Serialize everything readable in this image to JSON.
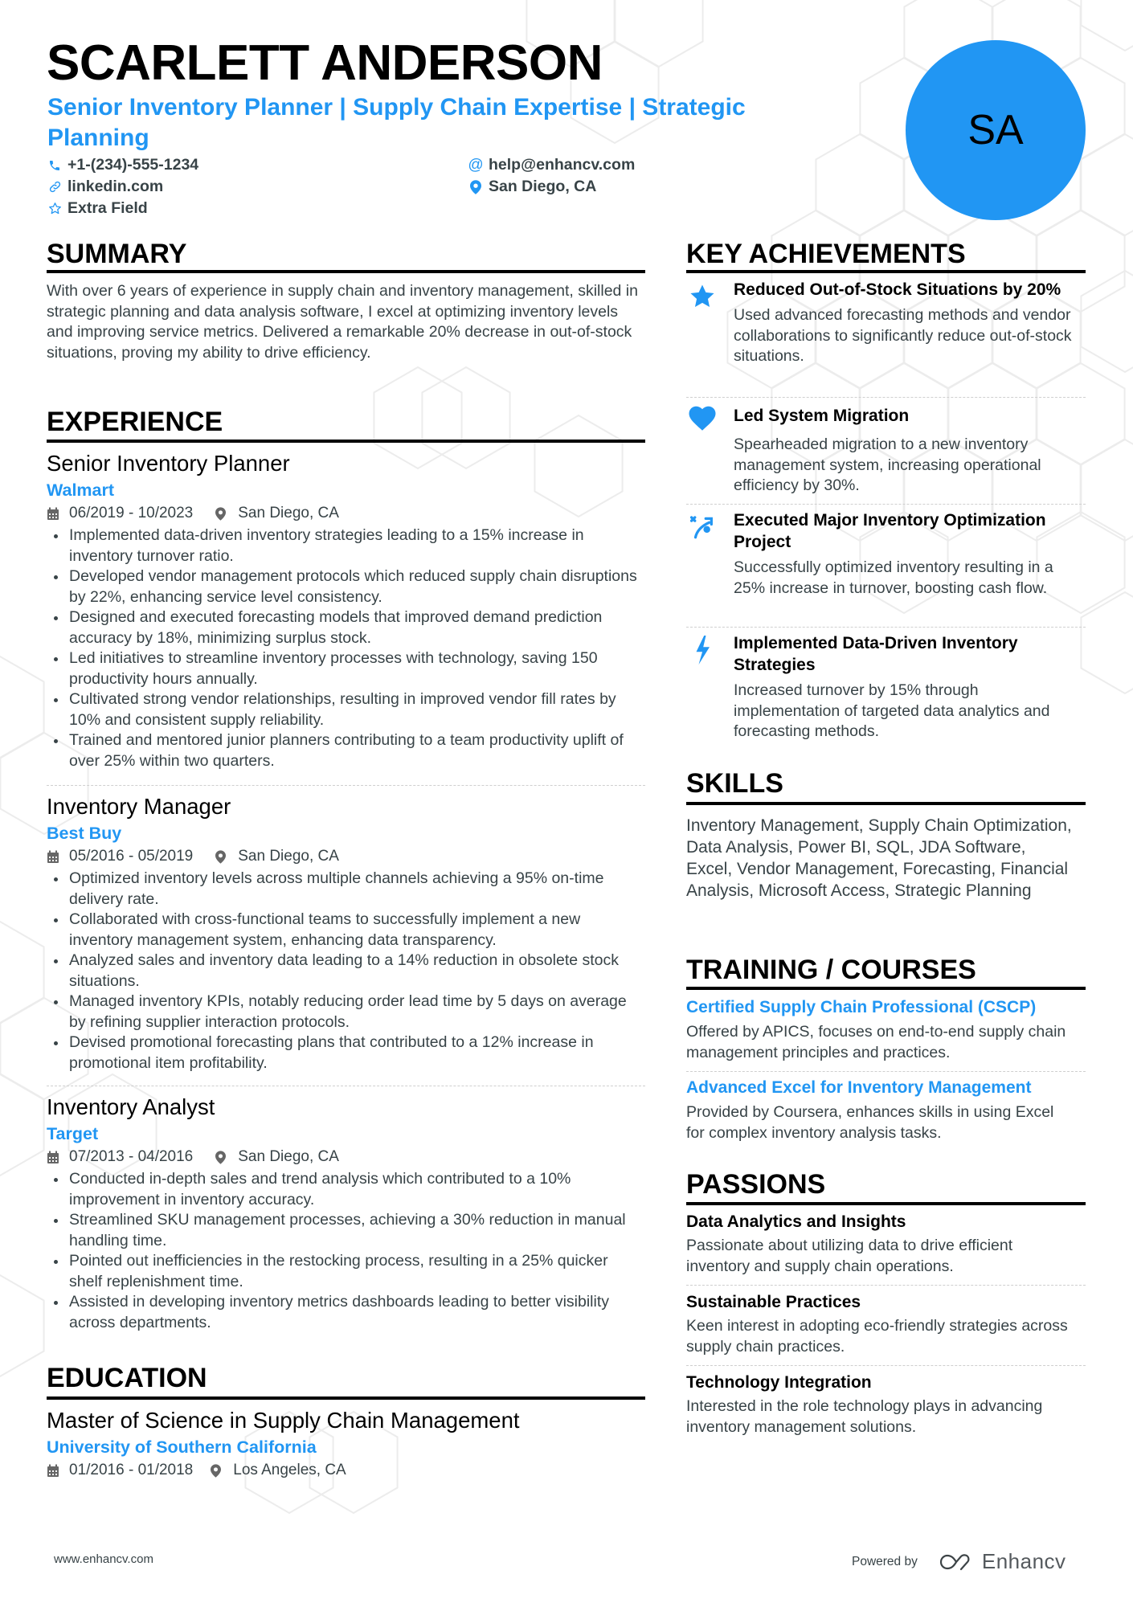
{
  "header": {
    "name": "SCARLETT ANDERSON",
    "title": "Senior Inventory Planner | Supply Chain Expertise | Strategic Planning",
    "initials": "SA",
    "contacts": {
      "phone": "+1-(234)-555-1234",
      "email": "help@enhancv.com",
      "linkedin": "linkedin.com",
      "location": "San Diego, CA",
      "extra": "Extra Field"
    }
  },
  "colors": {
    "accent": "#2196F3",
    "text": "#384347",
    "heading": "#000000"
  },
  "summary": {
    "heading": "SUMMARY",
    "text": "With over 6 years of experience in supply chain and inventory management, skilled in strategic planning and data analysis software, I excel at optimizing inventory levels and improving service metrics. Delivered a remarkable 20% decrease in out-of-stock situations, proving my ability to drive efficiency."
  },
  "experience": {
    "heading": "EXPERIENCE",
    "jobs": [
      {
        "title": "Senior Inventory Planner",
        "company": "Walmart",
        "dates": "06/2019 - 10/2023",
        "location": "San Diego, CA",
        "bullets": [
          "Implemented data-driven inventory strategies leading to a 15% increase in inventory turnover ratio.",
          "Developed vendor management protocols which reduced supply chain disruptions by 22%, enhancing service level consistency.",
          "Designed and executed forecasting models that improved demand prediction accuracy by 18%, minimizing surplus stock.",
          "Led initiatives to streamline inventory processes with technology, saving 150 productivity hours annually.",
          "Cultivated strong vendor relationships, resulting in improved vendor fill rates by 10% and consistent supply reliability.",
          "Trained and mentored junior planners contributing to a team productivity uplift of over 25% within two quarters."
        ]
      },
      {
        "title": "Inventory Manager",
        "company": "Best Buy",
        "dates": "05/2016 - 05/2019",
        "location": "San Diego, CA",
        "bullets": [
          "Optimized inventory levels across multiple channels achieving a 95% on-time delivery rate.",
          "Collaborated with cross-functional teams to successfully implement a new inventory management system, enhancing data transparency.",
          "Analyzed sales and inventory data leading to a 14% reduction in obsolete stock situations.",
          "Managed inventory KPIs, notably reducing order lead time by 5 days on average by refining supplier interaction protocols.",
          "Devised promotional forecasting plans that contributed to a 12% increase in promotional item profitability."
        ]
      },
      {
        "title": "Inventory Analyst",
        "company": "Target",
        "dates": "07/2013 - 04/2016",
        "location": "San Diego, CA",
        "bullets": [
          "Conducted in-depth sales and trend analysis which contributed to a 10% improvement in inventory accuracy.",
          "Streamlined SKU management processes, achieving a 30% reduction in manual handling time.",
          "Pointed out inefficiencies in the restocking process, resulting in a 25% quicker shelf replenishment time.",
          "Assisted in developing inventory metrics dashboards leading to better visibility across departments."
        ]
      }
    ]
  },
  "education": {
    "heading": "EDUCATION",
    "degree": "Master of Science in Supply Chain Management",
    "school": "University of Southern California",
    "dates": "01/2016 - 01/2018",
    "location": "Los Angeles, CA"
  },
  "achievements": {
    "heading": "KEY ACHIEVEMENTS",
    "items": [
      {
        "icon": "star-icon",
        "title": "Reduced Out-of-Stock Situations by 20%",
        "desc": "Used advanced forecasting methods and vendor collaborations to significantly reduce out-of-stock situations."
      },
      {
        "icon": "heart-icon",
        "title": "Led System Migration",
        "desc": "Spearheaded migration to a new inventory management system, increasing operational efficiency by 30%."
      },
      {
        "icon": "strategy-icon",
        "title": "Executed Major Inventory Optimization Project",
        "desc": "Successfully optimized inventory resulting in a 25% increase in turnover, boosting cash flow."
      },
      {
        "icon": "bolt-icon",
        "title": "Implemented Data-Driven Inventory Strategies",
        "desc": "Increased turnover by 15% through implementation of targeted data analytics and forecasting methods."
      }
    ]
  },
  "skills": {
    "heading": "SKILLS",
    "text": "Inventory Management, Supply Chain Optimization, Data Analysis, Power BI, SQL, JDA Software, Excel, Vendor Management, Forecasting, Financial Analysis, Microsoft Access, Strategic Planning"
  },
  "training": {
    "heading": "TRAINING / COURSES",
    "items": [
      {
        "title": "Certified Supply Chain Professional (CSCP)",
        "desc": "Offered by APICS, focuses on end-to-end supply chain management principles and practices."
      },
      {
        "title": "Advanced Excel for Inventory Management",
        "desc": "Provided by Coursera, enhances skills in using Excel for complex inventory analysis tasks."
      }
    ]
  },
  "passions": {
    "heading": "PASSIONS",
    "items": [
      {
        "title": "Data Analytics and Insights",
        "desc": "Passionate about utilizing data to drive efficient inventory and supply chain operations."
      },
      {
        "title": "Sustainable Practices",
        "desc": "Keen interest in adopting eco-friendly strategies across supply chain practices."
      },
      {
        "title": "Technology Integration",
        "desc": "Interested in the role technology plays in advancing inventory management solutions."
      }
    ]
  },
  "footer": {
    "website": "www.enhancv.com",
    "powered_by": "Powered by",
    "brand": "Enhancv"
  }
}
